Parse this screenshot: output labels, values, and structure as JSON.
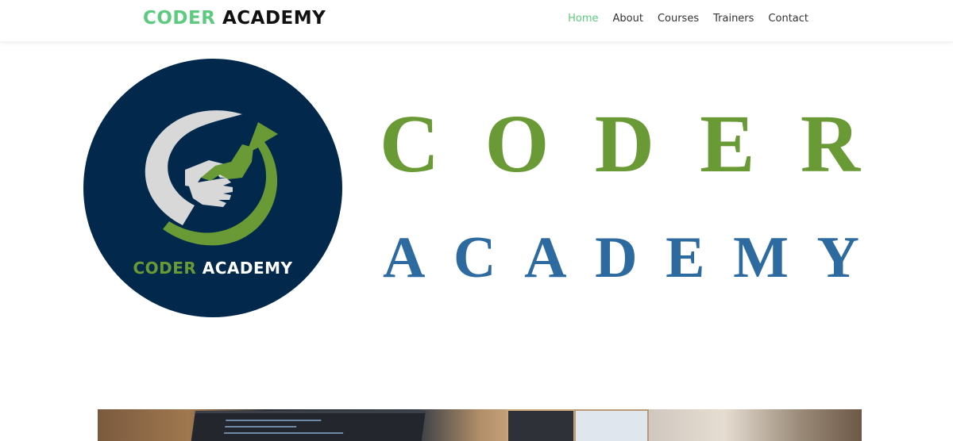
{
  "header": {
    "brand_part1": "CODER",
    "brand_part2": "ACADEMY",
    "nav": [
      {
        "label": "Home",
        "active": true
      },
      {
        "label": "About",
        "active": false
      },
      {
        "label": "Courses",
        "active": false
      },
      {
        "label": "Trainers",
        "active": false
      },
      {
        "label": "Contact",
        "active": false
      }
    ]
  },
  "logo_banner": {
    "emblem_text_part1": "CODER",
    "emblem_text_part2": "ACADEMY",
    "word1_letters": [
      "C",
      "O",
      "D",
      "E",
      "R"
    ],
    "word2_letters": [
      "A",
      "C",
      "A",
      "D",
      "E",
      "M",
      "Y"
    ]
  },
  "colors": {
    "accent_green": "#5ccb7f",
    "logo_green": "#6a9a35",
    "logo_blue": "#2d6aa0",
    "emblem_navy": "#02294c"
  }
}
